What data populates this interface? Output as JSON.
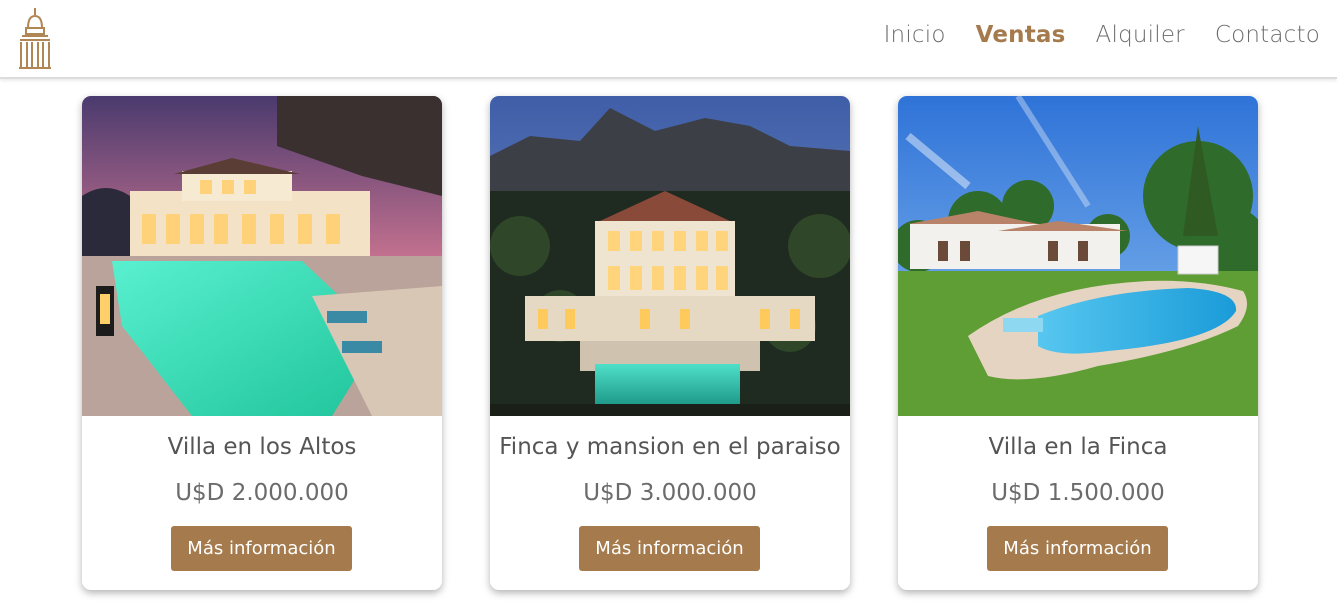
{
  "brand": {
    "logo_icon": "building-dome-icon",
    "accent_color": "#a57a4c"
  },
  "nav": {
    "items": [
      {
        "label": "Inicio",
        "active": false
      },
      {
        "label": "Ventas",
        "active": true
      },
      {
        "label": "Alquiler",
        "active": false
      },
      {
        "label": "Contacto",
        "active": false
      }
    ]
  },
  "listings": [
    {
      "title": "Villa en los Altos",
      "price": "U$D 2.000.000",
      "button": "Más información",
      "image": "villa-pool-sunset-photo"
    },
    {
      "title": "Finca y mansion en el paraiso",
      "price": "U$D 3.000.000",
      "button": "Más información",
      "image": "mansion-mountain-night-photo"
    },
    {
      "title": "Villa en la Finca",
      "price": "U$D 1.500.000",
      "button": "Más información",
      "image": "villa-garden-pool-day-photo"
    }
  ]
}
